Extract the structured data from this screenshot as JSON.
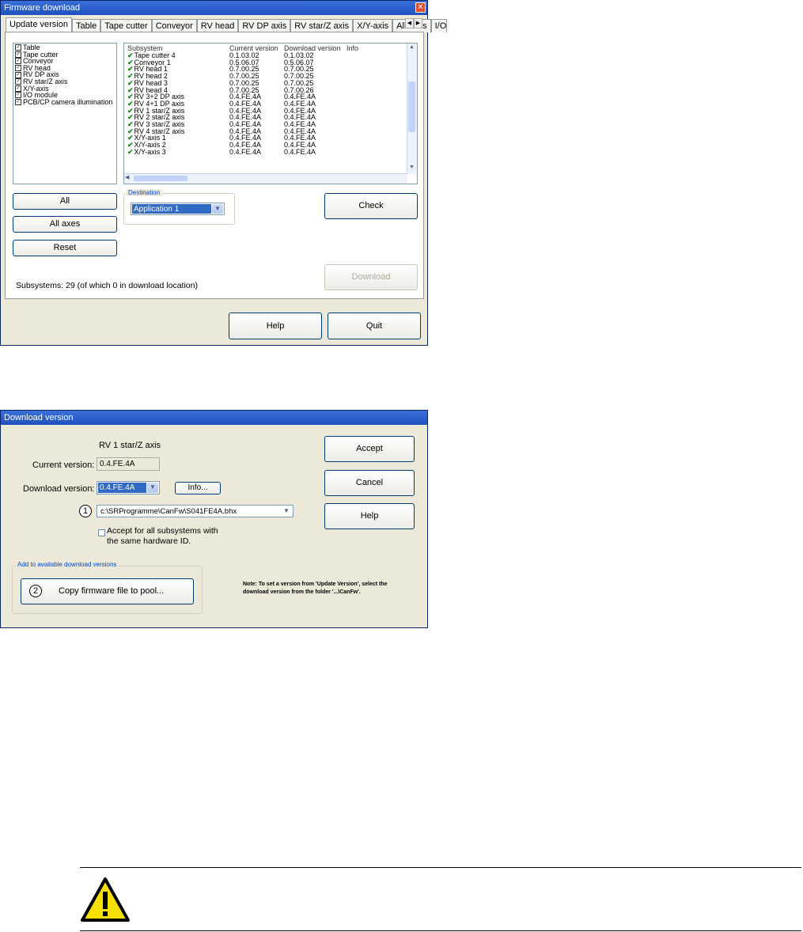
{
  "fw": {
    "title": "Firmware download",
    "close": "✕",
    "tabs": [
      "Update version",
      "Table",
      "Tape cutter",
      "Conveyor",
      "RV head",
      "RV DP axis",
      "RV star/Z axis",
      "X/Y-axis",
      "All axes",
      "I/O"
    ],
    "subsystem_checks": [
      "Table",
      "Tape cutter",
      "Conveyor",
      "RV head",
      "RV DP axis",
      "RV star/Z axis",
      "X/Y-axis",
      "I/O module",
      "PCB/CP camera illumination"
    ],
    "table_headers": [
      "Subsystem",
      "Current version",
      "Download version",
      "Info"
    ],
    "rows": [
      [
        "Tape cutter 4",
        "0.1.03.02",
        "0.1.03.02"
      ],
      [
        "Conveyor 1",
        "0.5.06.07",
        "0.5.06.07"
      ],
      [
        "RV head 1",
        "0.7.00.25",
        "0.7.00.25"
      ],
      [
        "RV head 2",
        "0.7.00.25",
        "0.7.00.25"
      ],
      [
        "RV head 3",
        "0.7.00.25",
        "0.7.00.25"
      ],
      [
        "RV head 4",
        "0.7.00.25",
        "0.7.00.26"
      ],
      [
        "RV 3+2 DP axis",
        "0.4.FE.4A",
        "0.4.FE.4A"
      ],
      [
        "RV 4+1 DP axis",
        "0.4.FE.4A",
        "0.4.FE.4A"
      ],
      [
        "RV 1 star/Z axis",
        "0.4.FE.4A",
        "0.4.FE.4A"
      ],
      [
        "RV 2 star/Z axis",
        "0.4.FE.4A",
        "0.4.FE.4A"
      ],
      [
        "RV 3 star/Z axis",
        "0.4.FE.4A",
        "0.4.FE.4A"
      ],
      [
        "RV 4 star/Z axis",
        "0.4.FE.4A",
        "0.4.FE.4A"
      ],
      [
        "X/Y-axis 1",
        "0.4.FE.4A",
        "0.4.FE.4A"
      ],
      [
        "X/Y-axis 2",
        "0.4.FE.4A",
        "0.4.FE.4A"
      ],
      [
        "X/Y-axis 3",
        "0.4.FE.4A",
        "0.4.FE.4A"
      ]
    ],
    "btn_all": "All",
    "btn_all_axes": "All axes",
    "btn_reset": "Reset",
    "destination_label": "Destination",
    "destination_value": "Application 1",
    "btn_check": "Check",
    "btn_download": "Download",
    "status": "Subsystems: 29 (of which 0 in download location)",
    "btn_help": "Help",
    "btn_quit": "Quit"
  },
  "dv": {
    "title": "Download version",
    "subsystem_name": "RV 1 star/Z axis",
    "current_label": "Current version:",
    "current_value": "0.4.FE.4A",
    "download_label": "Download version:",
    "download_value": "0.4.FE.4A",
    "btn_info": "Info...",
    "marker1": "1",
    "path_value": "c:\\SRProgramme\\CanFw\\S041FE4A.bhx",
    "accept_all_line1": "Accept for all subsystems with",
    "accept_all_line2": "the same hardware ID.",
    "group_label": "Add to available download versions",
    "marker2": "2",
    "btn_copy": "Copy firmware file to pool...",
    "btn_accept": "Accept",
    "btn_cancel": "Cancel",
    "btn_help": "Help",
    "note_line1": "Note: To set a version from 'Update Version', select the",
    "note_line2": "download version from the folder '...\\CanFw'."
  },
  "colors": {
    "titlebar": "#1f50c0",
    "dialog_bg": "#ece9d8",
    "check_green": "#1e8a1e",
    "warning_yellow": "#f5e000"
  },
  "icons": {
    "warning": "warning-triangle-icon",
    "tick": "check-mark-icon"
  }
}
